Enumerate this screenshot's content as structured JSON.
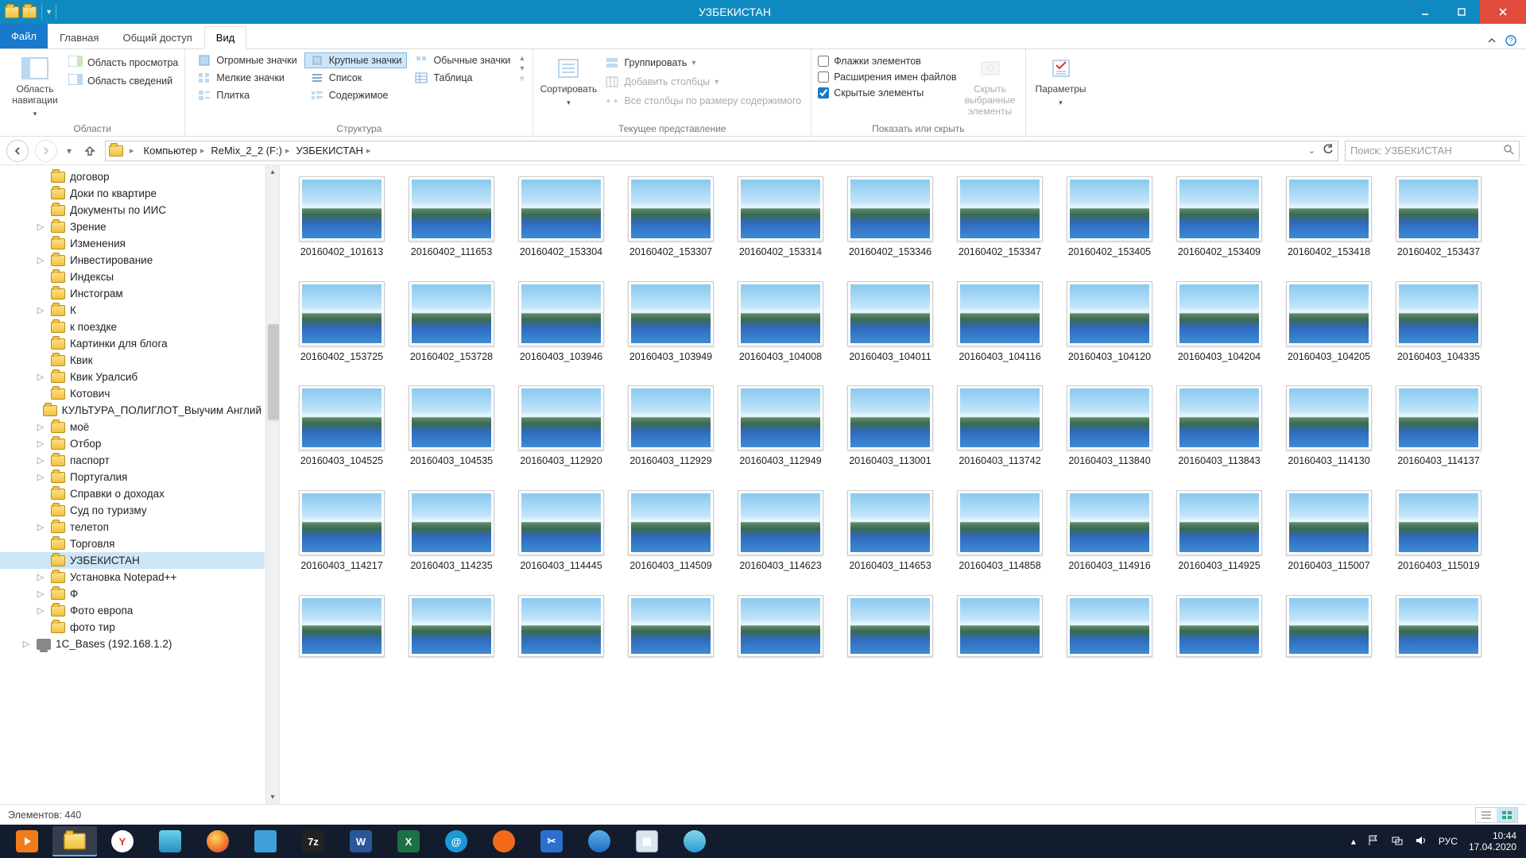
{
  "window_title": "УЗБЕКИСТАН",
  "menu": {
    "file": "Файл",
    "tabs": [
      "Главная",
      "Общий доступ",
      "Вид"
    ],
    "active_tab": 2
  },
  "ribbon": {
    "panes": {
      "nav_pane": "Область навигации",
      "preview_pane": "Область просмотра",
      "details_pane": "Область сведений",
      "group_label_areas": "Области"
    },
    "layout": {
      "huge": "Огромные значки",
      "large": "Крупные значки",
      "medium": "Обычные значки",
      "small": "Мелкие значки",
      "list": "Список",
      "table": "Таблица",
      "tiles": "Плитка",
      "content": "Содержимое",
      "group_label": "Структура"
    },
    "current_view": {
      "sort": "Сортировать",
      "group": "Группировать",
      "add_cols": "Добавить столбцы",
      "autofit": "Все столбцы по размеру содержимого",
      "group_label": "Текущее представление"
    },
    "show_hide": {
      "checkboxes": "Флажки элементов",
      "extensions": "Расширения имен файлов",
      "hidden": "Скрытые элементы",
      "hide_selected": "Скрыть выбранные элементы",
      "group_label": "Показать или скрыть"
    },
    "options": "Параметры"
  },
  "breadcrumb": [
    "Компьютер",
    "ReMix_2_2 (F:)",
    "УЗБЕКИСТАН"
  ],
  "search_placeholder": "Поиск: УЗБЕКИСТАН",
  "tree": [
    {
      "exp": "",
      "indent": 2,
      "label": "договор"
    },
    {
      "exp": "",
      "indent": 2,
      "label": "Доки по квартире"
    },
    {
      "exp": "",
      "indent": 2,
      "label": "Документы по ИИС"
    },
    {
      "exp": "▷",
      "indent": 2,
      "label": "Зрение"
    },
    {
      "exp": "",
      "indent": 2,
      "label": "Изменения"
    },
    {
      "exp": "▷",
      "indent": 2,
      "label": "Инвестирование"
    },
    {
      "exp": "",
      "indent": 2,
      "label": "Индексы"
    },
    {
      "exp": "",
      "indent": 2,
      "label": "Инстограм"
    },
    {
      "exp": "▷",
      "indent": 2,
      "label": "К"
    },
    {
      "exp": "",
      "indent": 2,
      "label": "к поездке"
    },
    {
      "exp": "",
      "indent": 2,
      "label": "Картинки для блога"
    },
    {
      "exp": "",
      "indent": 2,
      "label": "Квик"
    },
    {
      "exp": "▷",
      "indent": 2,
      "label": "Квик Уралсиб"
    },
    {
      "exp": "",
      "indent": 2,
      "label": "Котович"
    },
    {
      "exp": "",
      "indent": 2,
      "label": "КУЛЬТУРА_ПОЛИГЛОТ_Выучим Англий"
    },
    {
      "exp": "▷",
      "indent": 2,
      "label": "моё"
    },
    {
      "exp": "▷",
      "indent": 2,
      "label": "Отбор"
    },
    {
      "exp": "▷",
      "indent": 2,
      "label": "паспорт"
    },
    {
      "exp": "▷",
      "indent": 2,
      "label": "Португалия"
    },
    {
      "exp": "",
      "indent": 2,
      "label": "Справки о доходах"
    },
    {
      "exp": "",
      "indent": 2,
      "label": "Суд по туризму"
    },
    {
      "exp": "▷",
      "indent": 2,
      "label": "телетоп"
    },
    {
      "exp": "",
      "indent": 2,
      "label": "Торговля"
    },
    {
      "exp": "",
      "indent": 2,
      "label": "УЗБЕКИСТАН",
      "selected": true
    },
    {
      "exp": "▷",
      "indent": 2,
      "label": "Установка Notepad++"
    },
    {
      "exp": "▷",
      "indent": 2,
      "label": "Ф"
    },
    {
      "exp": "▷",
      "indent": 2,
      "label": "Фото европа"
    },
    {
      "exp": "",
      "indent": 2,
      "label": "фото тир"
    },
    {
      "exp": "▷",
      "indent": 1,
      "label": "1C_Bases (192.168.1.2)",
      "net": true
    }
  ],
  "files": [
    "20160402_101613",
    "20160402_111653",
    "20160402_153304",
    "20160402_153307",
    "20160402_153314",
    "20160402_153346",
    "20160402_153347",
    "20160402_153405",
    "20160402_153409",
    "20160402_153418",
    "20160402_153437",
    "20160402_153725",
    "20160402_153728",
    "20160403_103946",
    "20160403_103949",
    "20160403_104008",
    "20160403_104011",
    "20160403_104116",
    "20160403_104120",
    "20160403_104204",
    "20160403_104205",
    "20160403_104335",
    "20160403_104525",
    "20160403_104535",
    "20160403_112920",
    "20160403_112929",
    "20160403_112949",
    "20160403_113001",
    "20160403_113742",
    "20160403_113840",
    "20160403_113843",
    "20160403_114130",
    "20160403_114137",
    "20160403_114217",
    "20160403_114235",
    "20160403_114445",
    "20160403_114509",
    "20160403_114623",
    "20160403_114653",
    "20160403_114858",
    "20160403_114916",
    "20160403_114925",
    "20160403_115007",
    "20160403_115019",
    "",
    "",
    "",
    "",
    "",
    "",
    "",
    "",
    "",
    "",
    ""
  ],
  "status": {
    "count_label": "Элементов:",
    "count": "440"
  },
  "tray": {
    "lang": "РУС",
    "time": "10:44",
    "date": "17.04.2020"
  }
}
